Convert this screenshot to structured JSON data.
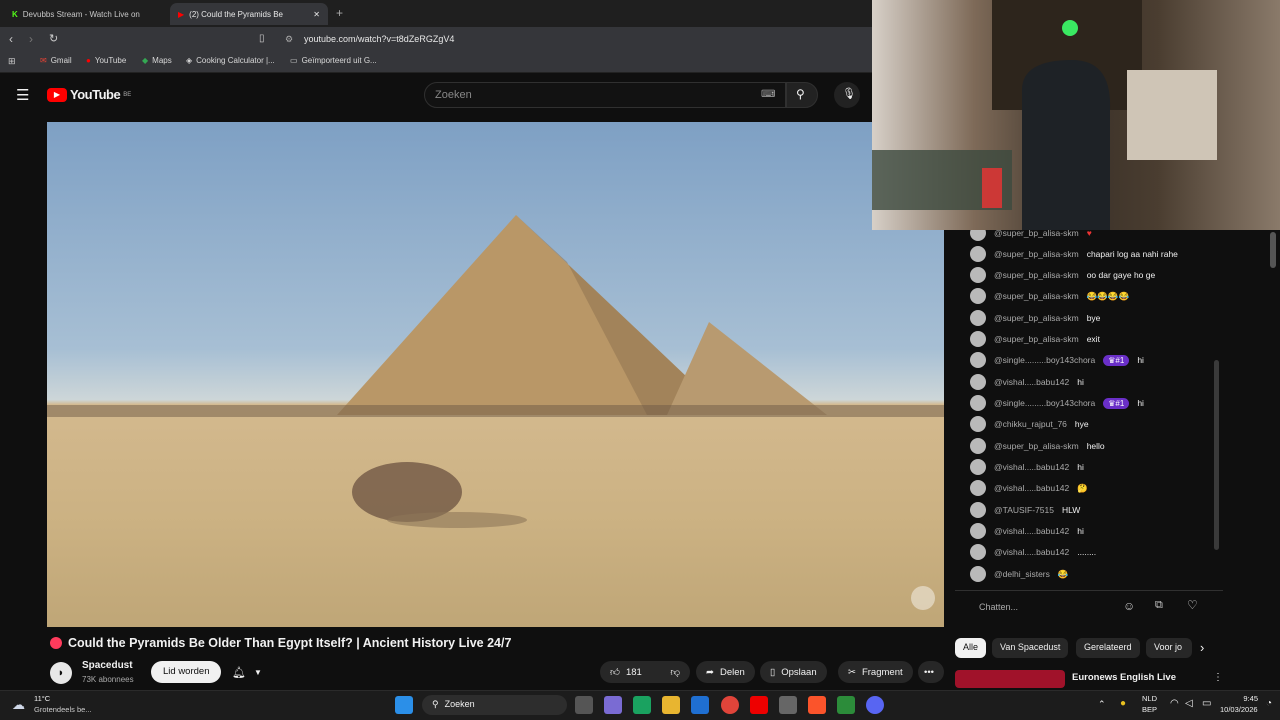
{
  "browser": {
    "tabs": [
      {
        "label": "Devubbs Stream - Watch Live on",
        "active": false
      },
      {
        "label": "(2)  Could the Pyramids Be",
        "active": true
      }
    ],
    "url": "youtube.com/watch?v=t8dZeRGZgV4",
    "bookmarks": [
      "Gmail",
      "YouTube",
      "Maps",
      "Cooking Calculator |...",
      "Geïmporteerd uit G..."
    ]
  },
  "youtube": {
    "logo_text": "YouTube",
    "region": "BE",
    "search_placeholder": "Zoeken"
  },
  "video": {
    "title": "Could the Pyramids Be Older Than Egypt Itself? | Ancient History Live 24/7",
    "channel": "Spacedust",
    "subscribers": "73K abonnees",
    "join_label": "Lid worden",
    "likes": "181",
    "share_label": "Delen",
    "save_label": "Opslaan",
    "clip_label": "Fragment"
  },
  "chat": {
    "messages": [
      {
        "author": "@super_bp_alisa-skm",
        "text": ""
      },
      {
        "author": "@super_bp_alisa-skm",
        "text": "chapari log aa nahi rahe"
      },
      {
        "author": "@super_bp_alisa-skm",
        "text": "oo dar gaye ho ge"
      },
      {
        "author": "@super_bp_alisa-skm",
        "text": "😂😂😂😂"
      },
      {
        "author": "@super_bp_alisa-skm",
        "text": "bye"
      },
      {
        "author": "@super_bp_alisa-skm",
        "text": "exit"
      },
      {
        "author": "@single.........boy143chora",
        "badge": "#1",
        "text": "hi"
      },
      {
        "author": "@vishal.....babu142",
        "text": "hi"
      },
      {
        "author": "@single.........boy143chora",
        "badge": "#1",
        "text": "hi"
      },
      {
        "author": "@chikku_rajput_76",
        "text": "hye"
      },
      {
        "author": "@super_bp_alisa-skm",
        "text": "hello"
      },
      {
        "author": "@vishal.....babu142",
        "text": "hi"
      },
      {
        "author": "@vishal.....babu142",
        "text": "🤔"
      },
      {
        "author": "@TAUSIF-7515",
        "text": "HLW"
      },
      {
        "author": "@vishal.....babu142",
        "text": "hi"
      },
      {
        "author": "@vishal.....babu142",
        "text": "........"
      },
      {
        "author": "@delhi_sisters",
        "text": "😂"
      }
    ],
    "input_placeholder": "Chatten..."
  },
  "filters": [
    "Alle",
    "Van Spacedust",
    "Gerelateerd",
    "Voor jo"
  ],
  "recommended_title": "Euronews English Live",
  "taskbar": {
    "weather_temp": "11°C",
    "weather_desc": "Grotendeels be...",
    "search_label": "Zoeken",
    "lang": "NLD",
    "lang2": "BEP",
    "time": "9:45",
    "date": "10/03/2026"
  }
}
